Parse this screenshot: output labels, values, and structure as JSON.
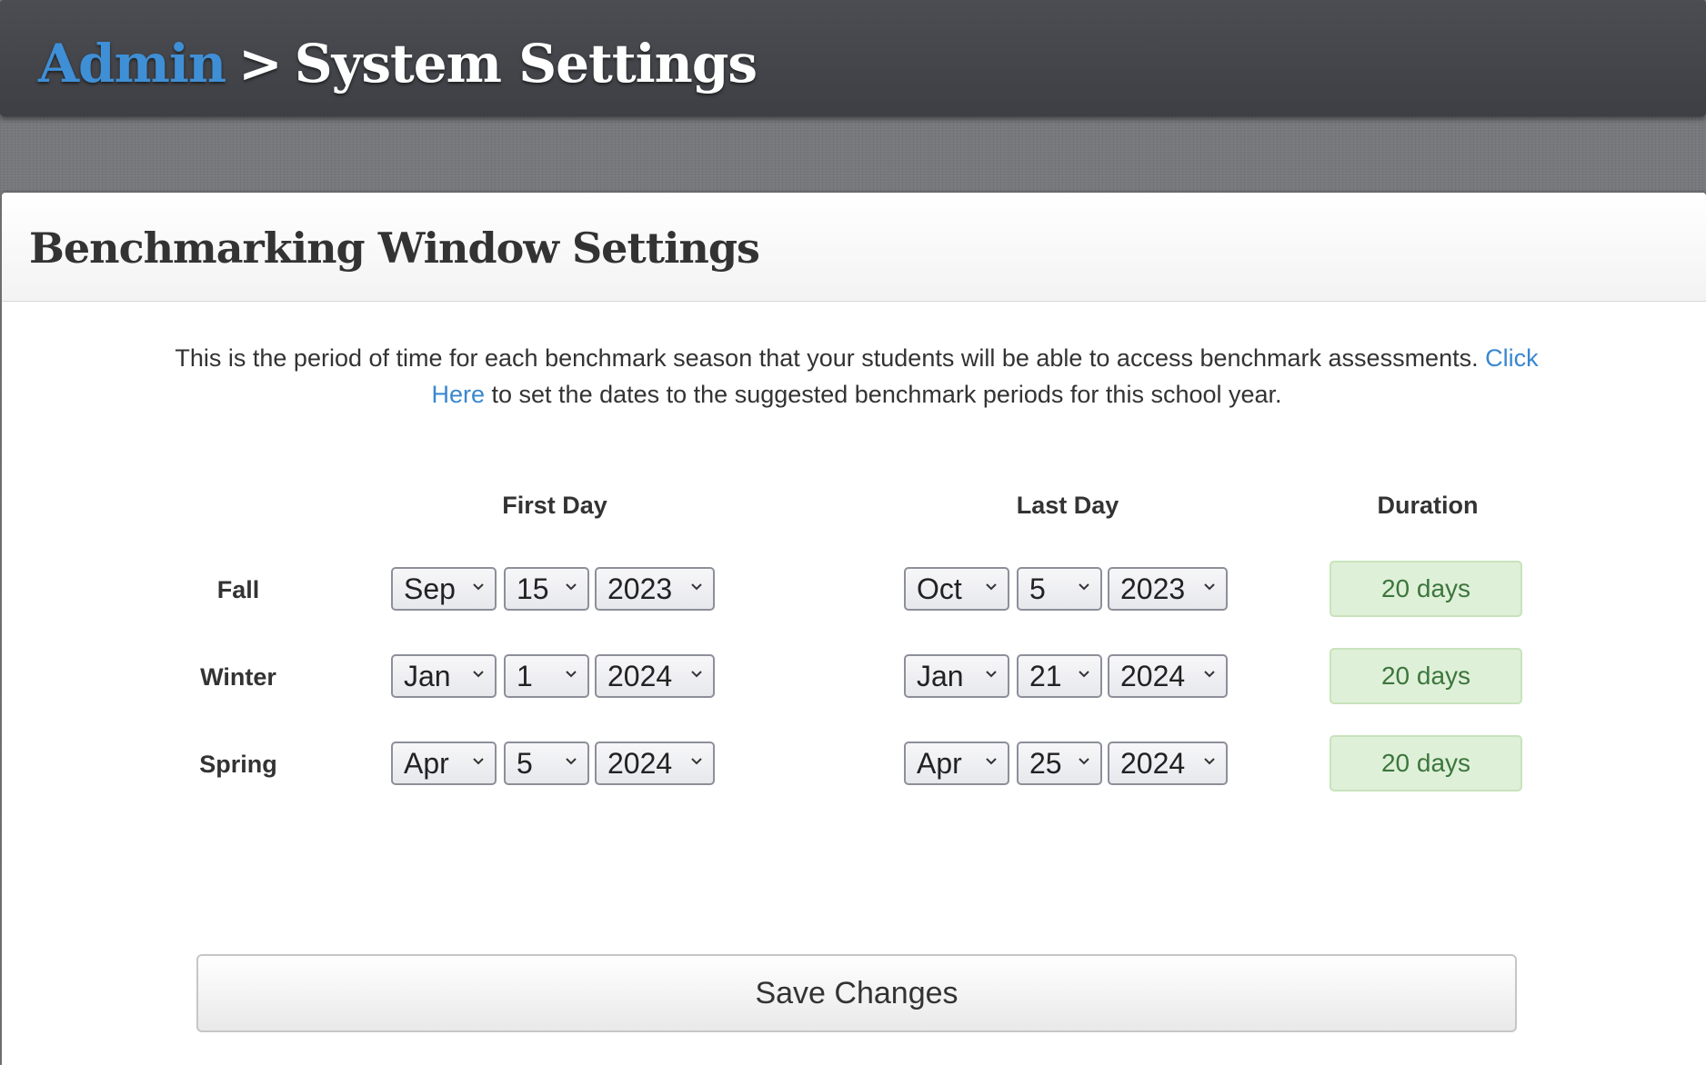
{
  "header": {
    "breadcrumb_link": "Admin",
    "separator": ">",
    "current_page": "System Settings"
  },
  "panel": {
    "title": "Benchmarking Window Settings",
    "description_before": "This is the period of time for each benchmark season that your students will be able to access benchmark assessments.",
    "description_link": "Click Here",
    "description_after": "to set the dates to the suggested benchmark periods for this school year."
  },
  "columns": {
    "first_day": "First Day",
    "last_day": "Last Day",
    "duration": "Duration"
  },
  "rows": [
    {
      "label": "Fall",
      "first": {
        "month": "Sep",
        "day": "15",
        "year": "2023"
      },
      "last": {
        "month": "Oct",
        "day": "5",
        "year": "2023"
      },
      "duration": "20 days"
    },
    {
      "label": "Winter",
      "first": {
        "month": "Jan",
        "day": "1",
        "year": "2024"
      },
      "last": {
        "month": "Jan",
        "day": "21",
        "year": "2024"
      },
      "duration": "20 days"
    },
    {
      "label": "Spring",
      "first": {
        "month": "Apr",
        "day": "5",
        "year": "2024"
      },
      "last": {
        "month": "Apr",
        "day": "25",
        "year": "2024"
      },
      "duration": "20 days"
    }
  ],
  "actions": {
    "save_label": "Save Changes"
  },
  "colors": {
    "link_blue": "#3f8fd6",
    "header_bg": "#46484d",
    "duration_bg": "#dff0d8",
    "duration_text": "#3c763d"
  }
}
